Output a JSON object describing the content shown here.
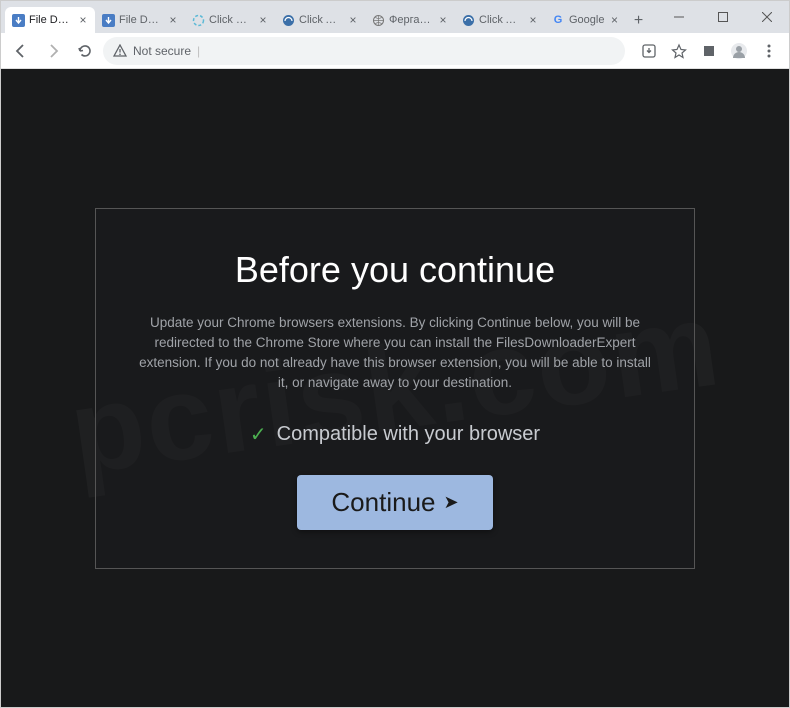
{
  "tabs": [
    {
      "title": "File Downl…",
      "favicon_color": "#4a7dc4"
    },
    {
      "title": "File Downl…",
      "favicon_color": "#4a7dc4"
    },
    {
      "title": "Click &quo…",
      "favicon_color": "#5bb9d6"
    },
    {
      "title": "Click Allow",
      "favicon_color": "#3b6fa8"
    },
    {
      "title": "Фергана -",
      "favicon_color": "#888"
    },
    {
      "title": "Click Allow",
      "favicon_color": "#3b6fa8"
    },
    {
      "title": "Google",
      "favicon_letter": "G"
    }
  ],
  "addressbar": {
    "security_label": "Not secure"
  },
  "modal": {
    "heading": "Before you continue",
    "body": "Update your Chrome browsers extensions. By clicking Continue below, you will be redirected to the Chrome Store where you can install the FilesDownloaderExpert extension. If you do not already have this browser extension, you will be able to install it, or navigate away to your destination.",
    "compat_text": "Compatible with your browser",
    "continue_label": "Continue"
  },
  "watermark": "pcrisk.com"
}
